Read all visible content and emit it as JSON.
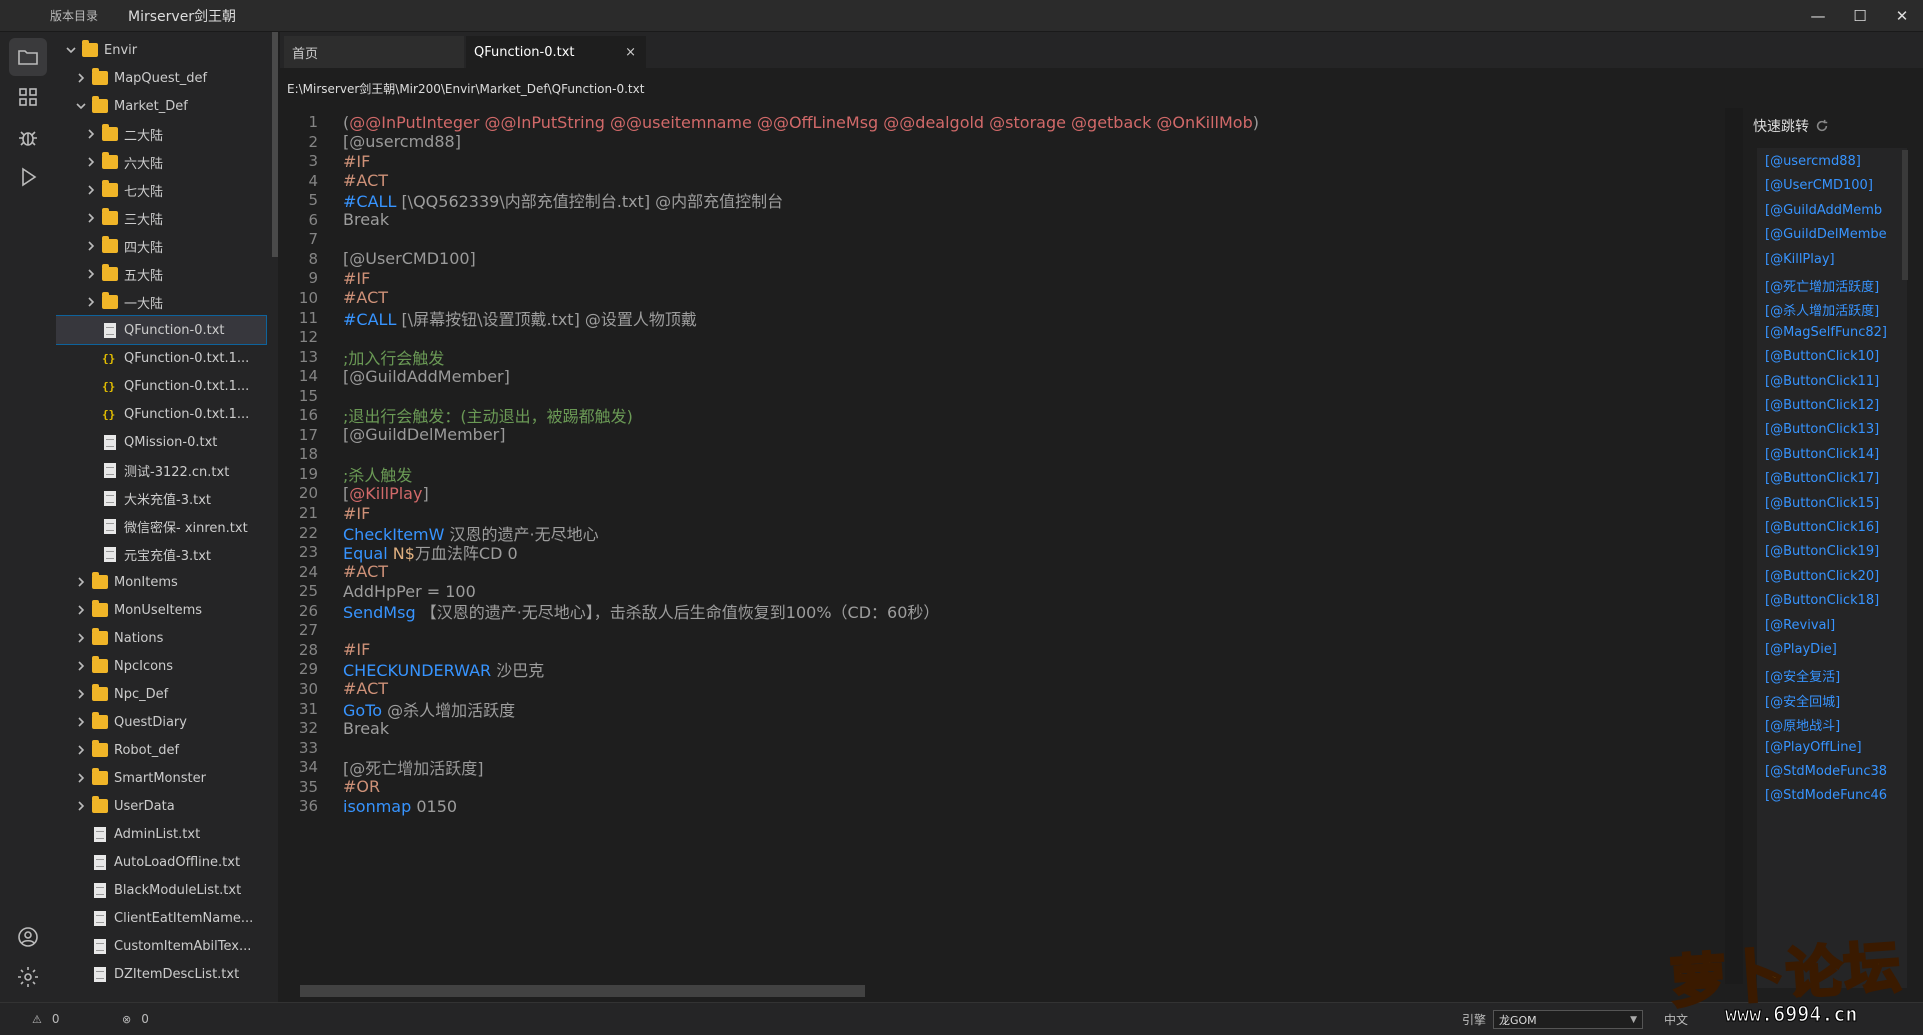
{
  "titlebar": {
    "menu": "版本目录",
    "title": "Mirserver剑王朝",
    "minimize": "—",
    "maximize": "☐",
    "close": "✕"
  },
  "activity": [
    "explorer-icon",
    "extensions-icon",
    "debug-icon",
    "run-icon",
    "account-icon",
    "settings-icon"
  ],
  "tree": [
    {
      "label": "Envir",
      "type": "folder",
      "expanded": true,
      "indent": 0
    },
    {
      "label": "MapQuest_def",
      "type": "folder",
      "expanded": false,
      "indent": 1
    },
    {
      "label": "Market_Def",
      "type": "folder",
      "expanded": true,
      "indent": 1
    },
    {
      "label": "二大陆",
      "type": "folder",
      "expanded": false,
      "indent": 2
    },
    {
      "label": "六大陆",
      "type": "folder",
      "expanded": false,
      "indent": 2
    },
    {
      "label": "七大陆",
      "type": "folder",
      "expanded": false,
      "indent": 2
    },
    {
      "label": "三大陆",
      "type": "folder",
      "expanded": false,
      "indent": 2
    },
    {
      "label": "四大陆",
      "type": "folder",
      "expanded": false,
      "indent": 2
    },
    {
      "label": "五大陆",
      "type": "folder",
      "expanded": false,
      "indent": 2
    },
    {
      "label": "一大陆",
      "type": "folder",
      "expanded": false,
      "indent": 2
    },
    {
      "label": "QFunction-0.txt",
      "type": "file",
      "indent": 2,
      "selected": true
    },
    {
      "label": "QFunction-0.txt.1...",
      "type": "json",
      "indent": 2
    },
    {
      "label": "QFunction-0.txt.1...",
      "type": "json",
      "indent": 2
    },
    {
      "label": "QFunction-0.txt.1...",
      "type": "json",
      "indent": 2
    },
    {
      "label": "QMission-0.txt",
      "type": "file",
      "indent": 2
    },
    {
      "label": "测试-3122.cn.txt",
      "type": "file",
      "indent": 2
    },
    {
      "label": "大米充值-3.txt",
      "type": "file",
      "indent": 2
    },
    {
      "label": "微信密保- xinren.txt",
      "type": "file",
      "indent": 2
    },
    {
      "label": "元宝充值-3.txt",
      "type": "file",
      "indent": 2
    },
    {
      "label": "MonItems",
      "type": "folder",
      "expanded": false,
      "indent": 1
    },
    {
      "label": "MonUseItems",
      "type": "folder",
      "expanded": false,
      "indent": 1
    },
    {
      "label": "Nations",
      "type": "folder",
      "expanded": false,
      "indent": 1
    },
    {
      "label": "NpcIcons",
      "type": "folder",
      "expanded": false,
      "indent": 1
    },
    {
      "label": "Npc_Def",
      "type": "folder",
      "expanded": false,
      "indent": 1
    },
    {
      "label": "QuestDiary",
      "type": "folder",
      "expanded": false,
      "indent": 1
    },
    {
      "label": "Robot_def",
      "type": "folder",
      "expanded": false,
      "indent": 1
    },
    {
      "label": "SmartMonster",
      "type": "folder",
      "expanded": false,
      "indent": 1
    },
    {
      "label": "UserData",
      "type": "folder",
      "expanded": false,
      "indent": 1
    },
    {
      "label": "AdminList.txt",
      "type": "file",
      "indent": 1
    },
    {
      "label": "AutoLoadOffline.txt",
      "type": "file",
      "indent": 1
    },
    {
      "label": "BlackModuleList.txt",
      "type": "file",
      "indent": 1
    },
    {
      "label": "ClientEatItemName...",
      "type": "file",
      "indent": 1
    },
    {
      "label": "CustomItemAbilTex...",
      "type": "file",
      "indent": 1
    },
    {
      "label": "DZItemDescList.txt",
      "type": "file",
      "indent": 1
    }
  ],
  "tabs": {
    "home": "首页",
    "active": "QFunction-0.txt",
    "close": "×"
  },
  "path": "E:\\Mirserver剑王朝\\Mir200\\Envir\\Market_Def\\QFunction-0.txt",
  "code": [
    {
      "n": "1",
      "parts": [
        [
          "c-label",
          "("
        ],
        [
          "c-red",
          "@@InPutInteger @@InPutString @@useitemname @@OffLineMsg @@dealgold @storage @getback @OnKillMob"
        ],
        [
          "c-label",
          ")"
        ]
      ]
    },
    {
      "n": "2",
      "parts": [
        [
          "c-label",
          "[@usercmd88]"
        ]
      ]
    },
    {
      "n": "3",
      "parts": [
        [
          "c-orange",
          "#IF"
        ]
      ]
    },
    {
      "n": "4",
      "parts": [
        [
          "c-orange",
          "#ACT"
        ]
      ]
    },
    {
      "n": "5",
      "parts": [
        [
          "c-blue",
          "#CALL "
        ],
        [
          "c-plain",
          "[\\QQ562339\\内部充值控制台.txt] @内部充值控制台"
        ]
      ]
    },
    {
      "n": "6",
      "parts": [
        [
          "c-plain",
          "Break"
        ]
      ]
    },
    {
      "n": "7",
      "parts": []
    },
    {
      "n": "8",
      "parts": [
        [
          "c-label",
          "[@UserCMD100]"
        ]
      ]
    },
    {
      "n": "9",
      "parts": [
        [
          "c-orange",
          "#IF"
        ]
      ]
    },
    {
      "n": "10",
      "parts": [
        [
          "c-orange",
          "#ACT"
        ]
      ]
    },
    {
      "n": "11",
      "parts": [
        [
          "c-blue",
          "#CALL "
        ],
        [
          "c-plain",
          "[\\屏幕按钮\\设置顶戴.txt] @设置人物顶戴"
        ]
      ]
    },
    {
      "n": "12",
      "parts": []
    },
    {
      "n": "13",
      "parts": [
        [
          "c-comment",
          ";加入行会触发"
        ]
      ]
    },
    {
      "n": "14",
      "parts": [
        [
          "c-label",
          "[@GuildAddMember]"
        ]
      ]
    },
    {
      "n": "15",
      "parts": []
    },
    {
      "n": "16",
      "parts": [
        [
          "c-comment",
          ";退出行会触发：(主动退出，被踢都触发)"
        ]
      ]
    },
    {
      "n": "17",
      "parts": [
        [
          "c-label",
          "[@GuildDelMember]"
        ]
      ]
    },
    {
      "n": "18",
      "parts": []
    },
    {
      "n": "19",
      "parts": [
        [
          "c-comment",
          ";杀人触发"
        ]
      ]
    },
    {
      "n": "20",
      "parts": [
        [
          "c-label",
          "["
        ],
        [
          "c-red",
          "@KillPlay"
        ],
        [
          "c-label",
          "]"
        ]
      ]
    },
    {
      "n": "21",
      "parts": [
        [
          "c-orange",
          "#IF"
        ]
      ]
    },
    {
      "n": "22",
      "parts": [
        [
          "c-blue",
          "CheckItemW "
        ],
        [
          "c-plain",
          "汉恩的遗产·无尽地心"
        ]
      ]
    },
    {
      "n": "23",
      "parts": [
        [
          "c-blue",
          "Equal "
        ],
        [
          "c-warm",
          "N$"
        ],
        [
          "c-plain",
          "万血法阵CD 0"
        ]
      ]
    },
    {
      "n": "24",
      "parts": [
        [
          "c-orange",
          "#ACT"
        ]
      ]
    },
    {
      "n": "25",
      "parts": [
        [
          "c-plain",
          "AddHpPer = 100"
        ]
      ]
    },
    {
      "n": "26",
      "parts": [
        [
          "c-blue",
          "SendMsg "
        ],
        [
          "c-plain",
          "【汉恩的遗产·无尽地心】，击杀敌人后生命值恢复到100%（CD：60秒）"
        ]
      ]
    },
    {
      "n": "27",
      "parts": []
    },
    {
      "n": "28",
      "parts": [
        [
          "c-orange",
          "#IF"
        ]
      ]
    },
    {
      "n": "29",
      "parts": [
        [
          "c-blue",
          "CHECKUNDERWAR "
        ],
        [
          "c-plain",
          "沙巴克"
        ]
      ]
    },
    {
      "n": "30",
      "parts": [
        [
          "c-orange",
          "#ACT"
        ]
      ]
    },
    {
      "n": "31",
      "parts": [
        [
          "c-blue",
          "GoTo "
        ],
        [
          "c-plain",
          "@杀人增加活跃度"
        ]
      ]
    },
    {
      "n": "32",
      "parts": [
        [
          "c-plain",
          "Break"
        ]
      ]
    },
    {
      "n": "33",
      "parts": []
    },
    {
      "n": "34",
      "parts": [
        [
          "c-label",
          "[@死亡增加活跃度]"
        ]
      ]
    },
    {
      "n": "35",
      "parts": [
        [
          "c-orange",
          "#OR"
        ]
      ]
    },
    {
      "n": "36",
      "parts": [
        [
          "c-blue",
          "isonmap "
        ],
        [
          "c-plain",
          "0150"
        ]
      ]
    }
  ],
  "quickjump": {
    "title": "快速跳转",
    "items": [
      "[@usercmd88]",
      "[@UserCMD100]",
      "[@GuildAddMemb",
      "[@GuildDelMembe",
      "[@KillPlay]",
      "[@死亡增加活跃度]",
      "[@杀人增加活跃度]",
      "[@MagSelfFunc82]",
      "[@ButtonClick10]",
      "[@ButtonClick11]",
      "[@ButtonClick12]",
      "[@ButtonClick13]",
      "[@ButtonClick14]",
      "[@ButtonClick17]",
      "[@ButtonClick15]",
      "[@ButtonClick16]",
      "[@ButtonClick19]",
      "[@ButtonClick20]",
      "[@ButtonClick18]",
      "[@Revival]",
      "[@PlayDie]",
      "[@安全复活]",
      "[@安全回城]",
      "[@原地战斗]",
      "[@PlayOffLine]",
      "[@StdModeFunc38",
      "[@StdModeFunc46"
    ]
  },
  "status": {
    "warnings": "0",
    "errors": "0",
    "engine_label": "引擎",
    "engine_value": "龙GOM",
    "lang": "中文"
  },
  "watermark": {
    "text": "萝卜论坛",
    "url": "www.6994.cn"
  }
}
